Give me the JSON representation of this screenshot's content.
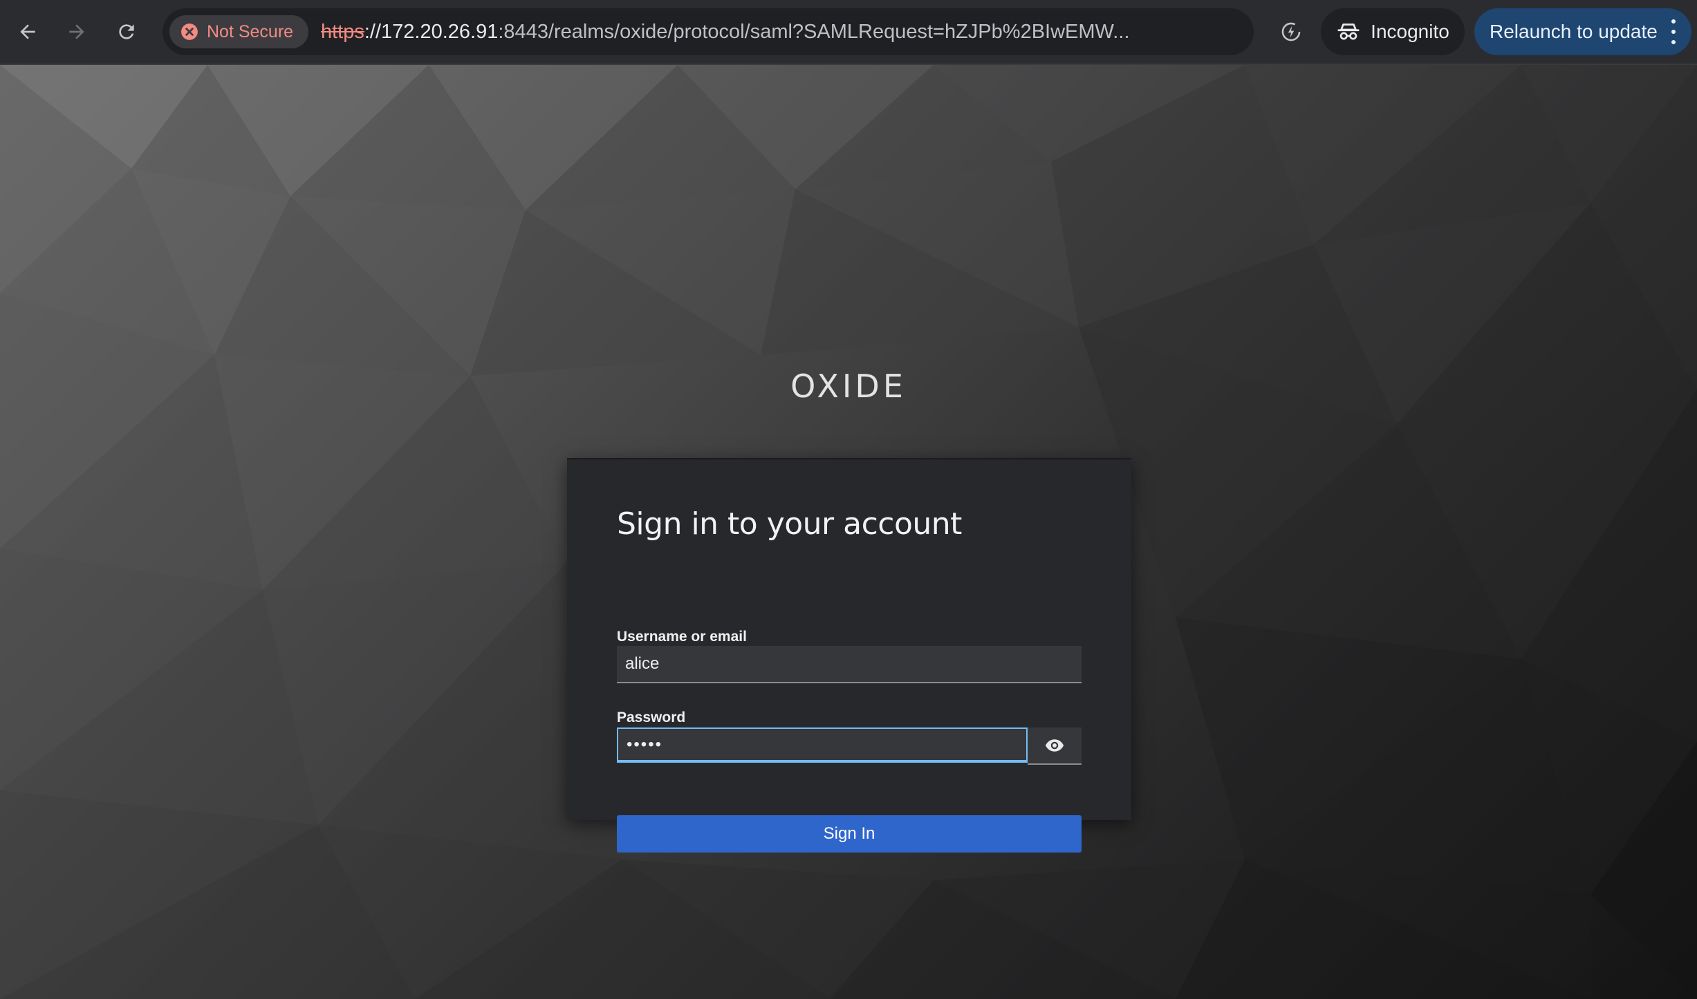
{
  "browser": {
    "security_label": "Not Secure",
    "url_scheme": "https",
    "url_host": "://172.20.26.91",
    "url_rest": ":8443/realms/oxide/protocol/saml?SAMLRequest=hZJPb%2BIwEMW...",
    "incognito_label": "Incognito",
    "relaunch_label": "Relaunch to update",
    "colors": {
      "toolbar_bg": "#2b2c2f",
      "warning": "#f28b82",
      "relaunch_bg": "#1e4670"
    }
  },
  "page": {
    "brand": "OXIDE",
    "title": "Sign in to your account",
    "username_label": "Username or email",
    "username_value": "alice",
    "password_label": "Password",
    "password_value": "•••••",
    "signin_label": "Sign In",
    "colors": {
      "card_bg": "#27282c",
      "primary": "#2f66cc",
      "focus": "#73bcf7"
    }
  }
}
